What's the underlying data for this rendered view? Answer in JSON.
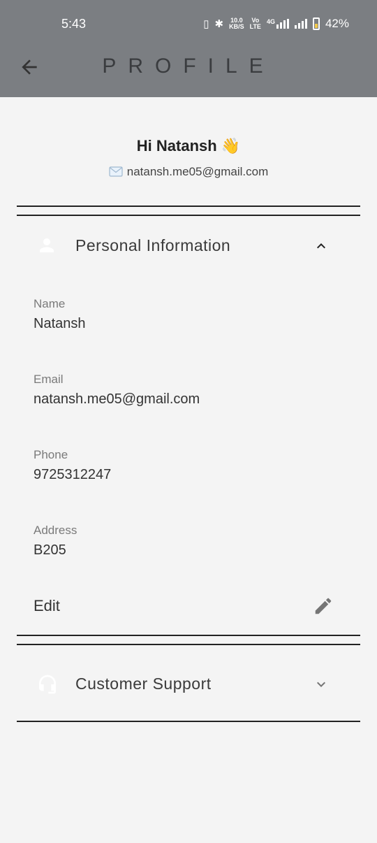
{
  "status_bar": {
    "time": "5:43",
    "net_speed_top": "10.0",
    "net_speed_bottom": "KB/S",
    "volte_top": "Vo",
    "volte_bottom": "LTE",
    "network_type": "4G",
    "battery": "42%"
  },
  "app_bar": {
    "title": "PROFILE",
    "back_icon": "arrow-back-icon"
  },
  "greeting": {
    "text": "Hi Natansh 👋",
    "email": "natansh.me05@gmail.com",
    "email_icon": "envelope-icon"
  },
  "personal_info": {
    "title": "Personal Information",
    "icon": "person-icon",
    "expanded": true,
    "fields": [
      {
        "label": "Name",
        "value": "Natansh"
      },
      {
        "label": "Email",
        "value": "natansh.me05@gmail.com"
      },
      {
        "label": "Phone",
        "value": "9725312247"
      },
      {
        "label": "Address",
        "value": "B205"
      }
    ],
    "edit_label": "Edit",
    "edit_icon": "pencil-icon"
  },
  "customer_support": {
    "title": "Customer Support",
    "icon": "headset-icon",
    "expanded": false
  },
  "colors": {
    "app_bar": "#7b7e82",
    "background": "#f4f4f4",
    "divider": "#222222",
    "icon_gray": "#757575"
  }
}
